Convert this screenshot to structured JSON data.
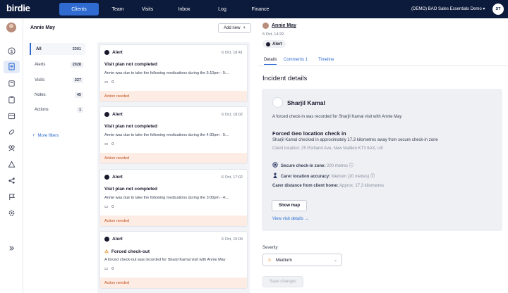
{
  "app": {
    "logo": "birdie"
  },
  "topnav": {
    "items": [
      "Clients",
      "Team",
      "Visits",
      "Inbox",
      "Log",
      "Finance"
    ],
    "agency": "(DEMO) BAO Sales Essentials Demo",
    "user_initials": "ST"
  },
  "client": {
    "name": "Annie May"
  },
  "filters": [
    {
      "label": "All",
      "count": "2301"
    },
    {
      "label": "Alerts",
      "count": "2028"
    },
    {
      "label": "Visits",
      "count": "227"
    },
    {
      "label": "Notes",
      "count": "45"
    },
    {
      "label": "Actions",
      "count": "1"
    }
  ],
  "more_filters": "More filters",
  "add_new": "Add new",
  "cards": [
    {
      "type": "Alert",
      "date": "6 Oct, 18:41",
      "title": "Visit plan not completed",
      "body": "Annie was due to take the following medications during the 5:10pm - 5:...",
      "comments": "0",
      "footer": "Action needed",
      "warning": false
    },
    {
      "type": "Alert",
      "date": "6 Oct, 18:02",
      "title": "Visit plan not completed",
      "body": "Annie was due to take the following medications during the 4:30pm - 5:...",
      "comments": "0",
      "footer": "Action needed",
      "warning": false
    },
    {
      "type": "Alert",
      "date": "6 Oct, 17:02",
      "title": "Visit plan not completed",
      "body": "Annie was due to take the following medications during the 3:00pm - 4:...",
      "comments": "0",
      "footer": "Action needed",
      "warning": false
    },
    {
      "type": "Alert",
      "date": "6 Oct, 15:09",
      "title": "Forced check-out",
      "body": "A forced check-out was recorded for Sharjil Kamal visit with Annie May",
      "comments": "0",
      "footer": "Action needed",
      "warning": true
    }
  ],
  "detail": {
    "name": "Annie May",
    "date": "6 Oct, 14:29",
    "badge": "Alert",
    "tabs": [
      "Details",
      "Comments 1",
      "Timeline"
    ],
    "incident_title": "Incident details",
    "carer_name": "Sharjil Kamal",
    "summary": "A forced check-in was recorded for Sharjil Kamal visit with Annie May",
    "heading": "Forced Geo location check in",
    "heading_sub": "Sharjil Kamal checked in approximately 17.3 kilometres away from secure check-in zone",
    "client_location": "Client location: 25 Portland Ave, New Malden KT3 6AX, UK",
    "secure_zone_label": "Secure check-in zone:",
    "secure_zone_value": "200 metres",
    "accuracy_label": "Carer location accuracy:",
    "accuracy_value": "Medium (20 metres)",
    "distance_label": "Carer distance from client home:",
    "distance_value": "Approx. 17.3 kilometres",
    "show_map": "Show map",
    "view_visit": "View visit details"
  },
  "severity": {
    "label": "Severity",
    "value": "Medium"
  },
  "save": "Save changes",
  "colors": {
    "topbar": "#0c1a3b",
    "accent": "#2f6bd1",
    "warning": "#c2501f"
  }
}
